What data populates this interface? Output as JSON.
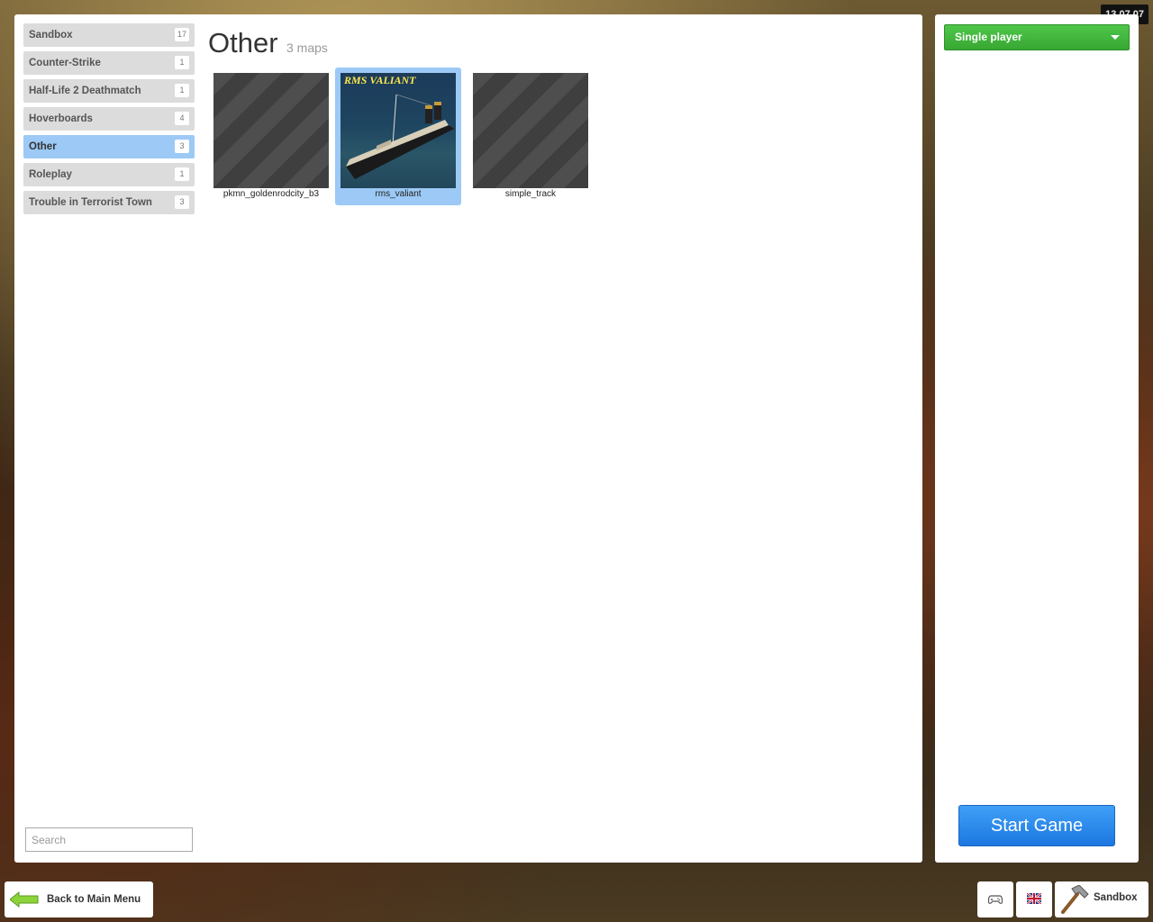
{
  "version": "13.07.07",
  "categories": [
    {
      "label": "Sandbox",
      "count": "17"
    },
    {
      "label": "Counter-Strike",
      "count": "1"
    },
    {
      "label": "Half-Life 2 Deathmatch",
      "count": "1"
    },
    {
      "label": "Hoverboards",
      "count": "4"
    },
    {
      "label": "Other",
      "count": "3"
    },
    {
      "label": "Roleplay",
      "count": "1"
    },
    {
      "label": "Trouble in Terrorist Town",
      "count": "3"
    }
  ],
  "selected_category": "Other",
  "search": {
    "placeholder": "Search",
    "value": ""
  },
  "header": {
    "title": "Other",
    "subtitle": "3 maps"
  },
  "maps": [
    {
      "name": "pkmn_goldenrodcity_b3",
      "thumbnail": "placeholder-stripes"
    },
    {
      "name": "rms_valiant",
      "thumbnail_text": "RMS VALIANT",
      "selected": true
    },
    {
      "name": "simple_track",
      "thumbnail": "placeholder-stripes"
    }
  ],
  "mode_select": {
    "value": "Single player"
  },
  "start_button": {
    "label": "Start Game"
  },
  "bottom": {
    "back_label": "Back to Main Menu",
    "gamemode_label": "Sandbox"
  },
  "icons": {
    "back": "green-left-arrow-icon",
    "controller": "gamepad-icon",
    "language": "uk-flag-icon",
    "gamemode": "hammer-icon"
  },
  "colors": {
    "selected": "#9cc9f5",
    "mode_select": "#3fb53a",
    "start_button": "#2a8cf0"
  }
}
